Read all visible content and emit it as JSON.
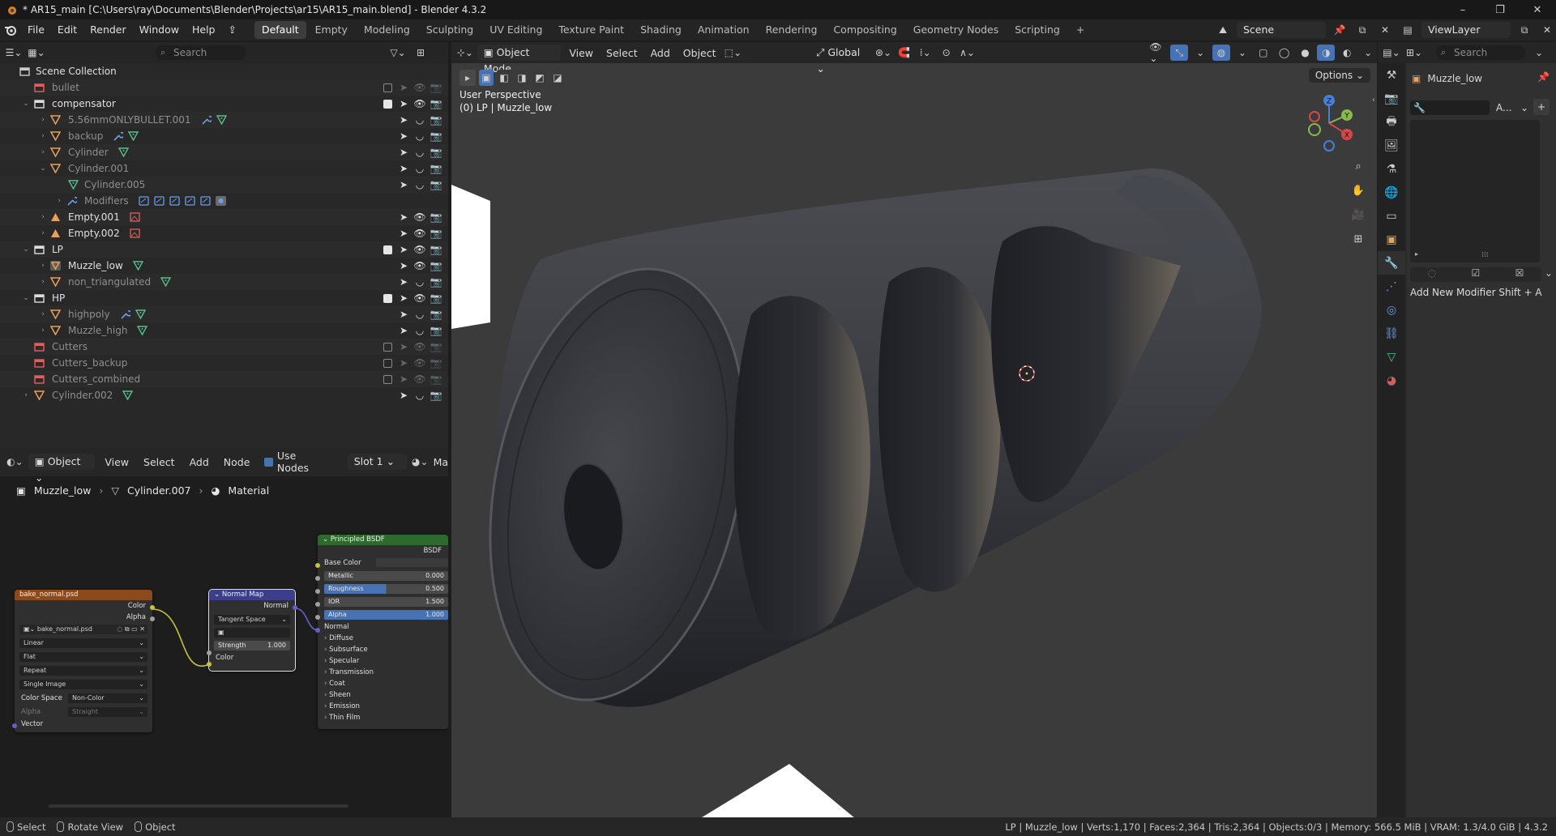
{
  "window": {
    "title": "* AR15_main [C:\\Users\\ray\\Documents\\Blender\\Projects\\ar15\\AR15_main.blend] - Blender 4.3.2",
    "controls": [
      "–",
      "❐",
      "✕"
    ]
  },
  "menu": [
    "File",
    "Edit",
    "Render",
    "Window",
    "Help"
  ],
  "workspaces": [
    "Default",
    "Empty",
    "Modeling",
    "Sculpting",
    "UV Editing",
    "Texture Paint",
    "Shading",
    "Animation",
    "Rendering",
    "Compositing",
    "Geometry Nodes",
    "Scripting"
  ],
  "active_workspace": "Default",
  "scene": {
    "name": "Scene",
    "view_layer": "ViewLayer"
  },
  "outliner": {
    "search_placeholder": "Search",
    "root": "Scene Collection",
    "rows": [
      {
        "label": "bullet",
        "dim": true
      },
      {
        "label": "compensator"
      },
      {
        "label": "5.56mmONLYBULLET.001",
        "dim": true
      },
      {
        "label": "backup",
        "dim": true
      },
      {
        "label": "Cylinder",
        "dim": true
      },
      {
        "label": "Cylinder.001",
        "dim": true
      },
      {
        "label": "Cylinder.005",
        "dim": true
      },
      {
        "label": "Modifiers",
        "dim": true
      },
      {
        "label": "Empty.001"
      },
      {
        "label": "Empty.002"
      },
      {
        "label": "LP"
      },
      {
        "label": "Muzzle_low"
      },
      {
        "label": "non_triangulated",
        "dim": true
      },
      {
        "label": "HP"
      },
      {
        "label": "highpoly",
        "dim": true
      },
      {
        "label": "Muzzle_high",
        "dim": true
      },
      {
        "label": "Cutters",
        "dim": true
      },
      {
        "label": "Cutters_backup",
        "dim": true
      },
      {
        "label": "Cutters_combined",
        "dim": true
      },
      {
        "label": "Cylinder.002",
        "dim": true
      }
    ]
  },
  "node_editor": {
    "type": "Object",
    "menus": [
      "View",
      "Select",
      "Add",
      "Node"
    ],
    "use_nodes_label": "Use Nodes",
    "slot": "Slot 1",
    "trailing": "Ma",
    "breadcrumb": [
      "Muzzle_low",
      "Cylinder.007",
      "Material"
    ],
    "image_node": {
      "title": "bake_normal.psd",
      "out_color": "Color",
      "out_alpha": "Alpha",
      "image": "bake_normal.psd",
      "interpolation": "Linear",
      "projection": "Flat",
      "extension": "Repeat",
      "source": "Single Image",
      "color_space_label": "Color Space",
      "color_space": "Non-Color",
      "alpha_label": "Alpha",
      "alpha_mode": "Straight",
      "in_vector": "Vector"
    },
    "normal_map_node": {
      "title": "Normal Map",
      "out_normal": "Normal",
      "space": "Tangent Space",
      "strength_label": "Strength",
      "strength": "1.000",
      "in_color": "Color"
    },
    "bsdf_node": {
      "title": "Principled BSDF",
      "out": "BSDF",
      "base_color": "Base Color",
      "metallic_label": "Metallic",
      "metallic": "0.000",
      "roughness_label": "Roughness",
      "roughness": "0.500",
      "ior_label": "IOR",
      "ior": "1.500",
      "alpha_label": "Alpha",
      "alpha": "1.000",
      "normal": "Normal",
      "sections": [
        "Diffuse",
        "Subsurface",
        "Specular",
        "Transmission",
        "Coat",
        "Sheen",
        "Emission",
        "Thin Film"
      ]
    }
  },
  "viewport": {
    "mode": "Object Mode",
    "menus": [
      "View",
      "Select",
      "Add",
      "Object"
    ],
    "orientation": "Global",
    "options": "Options",
    "view_name": "User Perspective",
    "object_info": "(0) LP | Muzzle_low",
    "gizmo": {
      "x": "X",
      "y": "Y",
      "z": "Z"
    }
  },
  "properties": {
    "search_placeholder": "Search",
    "object_name": "Muzzle_low",
    "add_modifier_abbrev": "A...",
    "hint": "Add New Modifier Shift + A"
  },
  "statusbar": {
    "hints": [
      "Select",
      "Rotate View",
      "Object"
    ],
    "stats": "LP | Muzzle_low | Verts:1,170 | Faces:2,364 | Tris:2,364 | Objects:0/3 | Memory: 566.5 MiB | VRAM: 1.3/4.0 GiB | 4.3.2"
  },
  "colors": {
    "accent": "#4772b3",
    "image_node_header": "#8a4a1c",
    "normal_map_header": "#3b3e8a",
    "bsdf_header": "#2e6a2e",
    "geometry_icon": "#58c08e",
    "object_icon": "#e8a05a",
    "collection_red": "#e06060"
  }
}
